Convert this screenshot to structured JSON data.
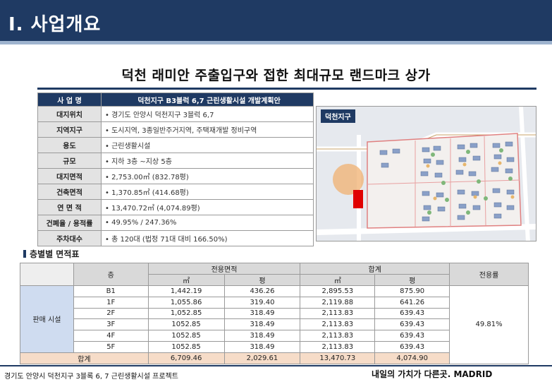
{
  "header": {
    "title": "Ⅰ. 사업개요"
  },
  "headline": "덕천 래미안 주출입구와  접한 최대규모 랜드마크 상가",
  "info_table": {
    "head": {
      "label": "사 업 명",
      "value": "덕천지구 B3블럭 6,7 근린생활시설 개발계획안"
    },
    "rows": [
      {
        "label": "대지위치",
        "value": "• 경기도 안양시 덕천지구 3블럭 6,7"
      },
      {
        "label": "지역지구",
        "value": "• 도시지역, 3종일반주거지역, 주택재개발 정비구역"
      },
      {
        "label": "용도",
        "value": "• 근린생활시설"
      },
      {
        "label": "규모",
        "value": "• 지하 3층 ~지상 5층"
      },
      {
        "label": "대지면적",
        "value": "• 2,753.00㎡ (832.78평)"
      },
      {
        "label": "건축면적",
        "value": "• 1,370.85㎡ (414.68평)"
      },
      {
        "label": "연 면 적",
        "value": "• 13,470.72㎡ (4,074.89평)"
      },
      {
        "label": "건폐율 / 용적률",
        "value": "• 49.95% / 247.36%"
      },
      {
        "label": "주차대수",
        "value": "• 총 120대 (법정 71대 대비 166.50%)"
      }
    ]
  },
  "map": {
    "tag": "덕천지구"
  },
  "area_section": {
    "title": "층별별 면적표",
    "headers": {
      "floor": "층",
      "exclusive": "전용면적",
      "total": "합계",
      "ratio": "전용률",
      "sqm": "㎡",
      "pyeong": "평"
    },
    "group_label": "판매 시설",
    "ratio_value": "49.81%",
    "rows": [
      {
        "floor": "B1",
        "ex_sqm": "1,442.19",
        "ex_py": "436.26",
        "tot_sqm": "2,895.53",
        "tot_py": "875.90"
      },
      {
        "floor": "1F",
        "ex_sqm": "1,055.86",
        "ex_py": "319.40",
        "tot_sqm": "2,119.88",
        "tot_py": "641.26"
      },
      {
        "floor": "2F",
        "ex_sqm": "1,052.85",
        "ex_py": "318.49",
        "tot_sqm": "2,113.83",
        "tot_py": "639.43"
      },
      {
        "floor": "3F",
        "ex_sqm": "1052.85",
        "ex_py": "318.49",
        "tot_sqm": "2,113.83",
        "tot_py": "639.43"
      },
      {
        "floor": "4F",
        "ex_sqm": "1052.85",
        "ex_py": "318.49",
        "tot_sqm": "2,113.83",
        "tot_py": "639.43"
      },
      {
        "floor": "5F",
        "ex_sqm": "1052.85",
        "ex_py": "318.49",
        "tot_sqm": "2,113.83",
        "tot_py": "639.43"
      }
    ],
    "total": {
      "label": "합계",
      "ex_sqm": "6,709.46",
      "ex_py": "2,029.61",
      "tot_sqm": "13,470.73",
      "tot_py": "4,074.90"
    }
  },
  "footer": {
    "left": "경기도 안양시 덕천지구 3블록  6, 7 근린생활시설  프로젝트",
    "right": "내일의 가치가 다른곳. MADRID"
  },
  "colors": {
    "navy": "#1f3a63",
    "highlight_red": "#e00000",
    "circle_orange": "#f0b070"
  }
}
